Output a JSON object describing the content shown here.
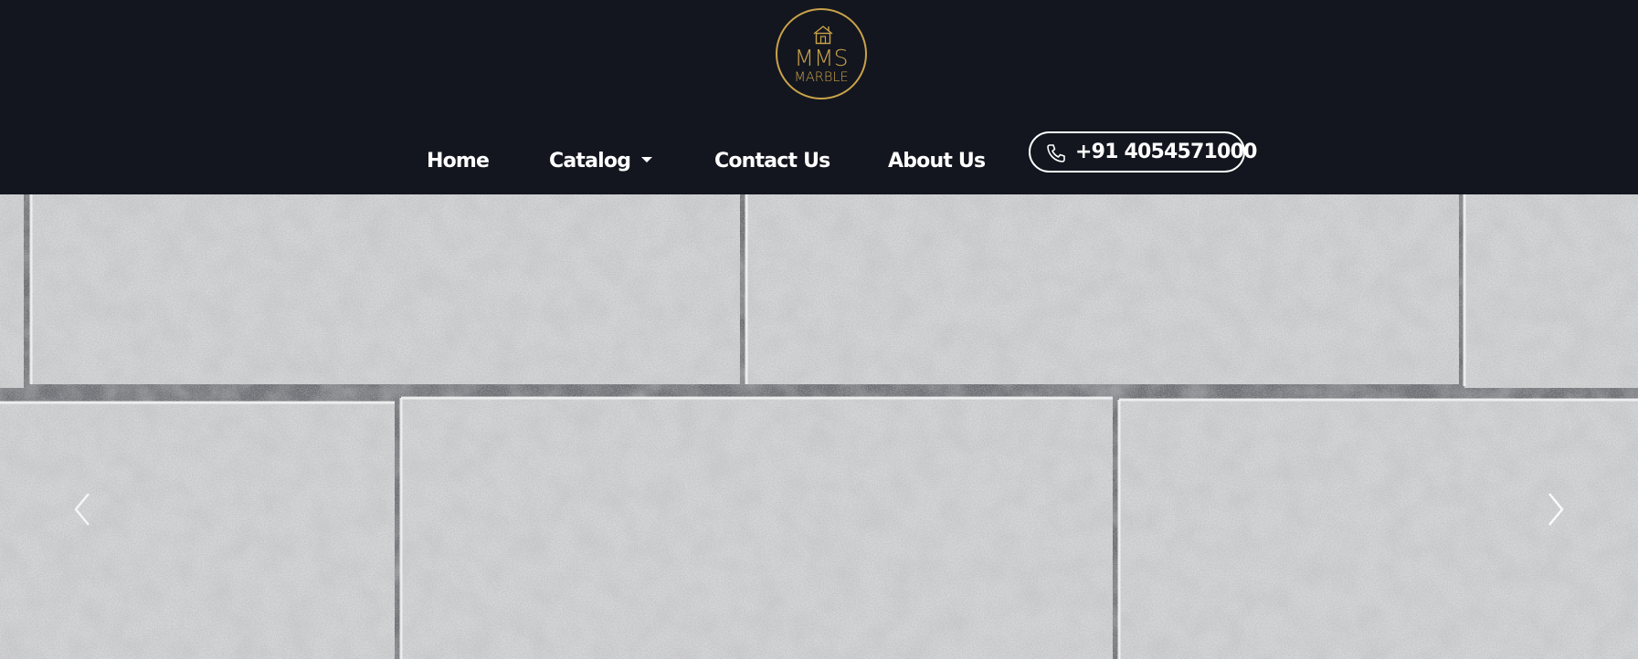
{
  "brand": {
    "logo_line1": "MMS",
    "logo_line2": "MARBLE",
    "logo_color": "#c9a24a",
    "house_icon": "house-icon"
  },
  "nav": {
    "items": [
      {
        "label": "Home"
      },
      {
        "label": "Catalog",
        "has_dropdown": true
      },
      {
        "label": "Contact Us"
      },
      {
        "label": "About Us"
      }
    ]
  },
  "phone": {
    "icon": "phone-icon",
    "number": "+91 4054571000"
  },
  "hero": {
    "image": "stone-wall-image",
    "prev_icon": "chevron-left-icon",
    "next_icon": "chevron-right-icon"
  },
  "colors": {
    "header_bg": "#13161f",
    "text": "#ffffff",
    "accent": "#c9a24a"
  }
}
